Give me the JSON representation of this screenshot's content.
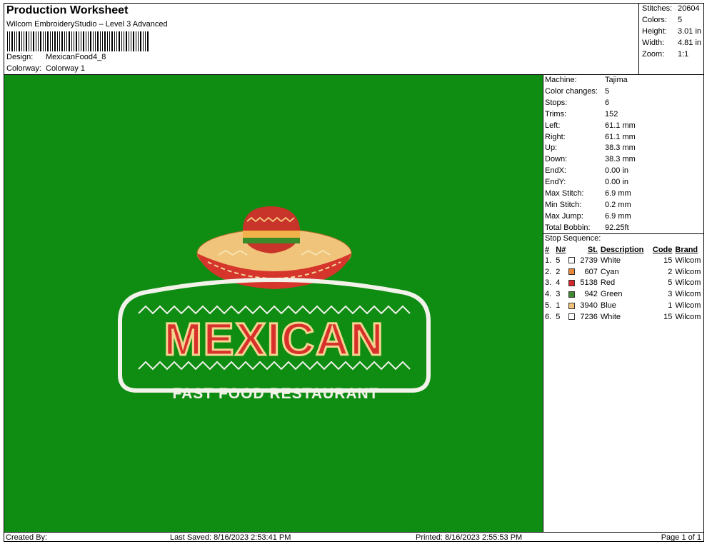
{
  "header": {
    "title": "Production Worksheet",
    "subtitle": "Wilcom EmbroideryStudio – Level 3 Advanced",
    "design_label": "Design:",
    "design_value": "MexicanFood4_8",
    "colorway_label": "Colorway:",
    "colorway_value": "Colorway 1"
  },
  "stats": [
    {
      "label": "Stitches:",
      "value": "20604"
    },
    {
      "label": "Colors:",
      "value": "5"
    },
    {
      "label": "Height:",
      "value": "3.01 in"
    },
    {
      "label": "Width:",
      "value": "4.81 in"
    },
    {
      "label": "Zoom:",
      "value": "1:1"
    }
  ],
  "machine_info": [
    {
      "label": "Machine:",
      "value": "Tajima"
    },
    {
      "label": "Color changes:",
      "value": "5"
    },
    {
      "label": "Stops:",
      "value": "6"
    },
    {
      "label": "Trims:",
      "value": "152"
    },
    {
      "label": "Left:",
      "value": "61.1 mm"
    },
    {
      "label": "Right:",
      "value": "61.1 mm"
    },
    {
      "label": "Up:",
      "value": "38.3 mm"
    },
    {
      "label": "Down:",
      "value": "38.3 mm"
    },
    {
      "label": "EndX:",
      "value": "0.00 in"
    },
    {
      "label": "EndY:",
      "value": "0.00 in"
    },
    {
      "label": "Max Stitch:",
      "value": "6.9 mm"
    },
    {
      "label": "Min Stitch:",
      "value": "0.2 mm"
    },
    {
      "label": "Max Jump:",
      "value": "6.9 mm"
    },
    {
      "label": "Total Bobbin:",
      "value": "92.25ft"
    }
  ],
  "stop_sequence": {
    "title": "Stop Sequence:",
    "columns": [
      "#",
      "N#",
      "St.",
      "Description",
      "Code",
      "Brand"
    ],
    "rows": [
      {
        "idx": "1.",
        "n": "5",
        "color": "#ffffff",
        "st": "2739",
        "desc": "White",
        "code": "15",
        "brand": "Wilcom"
      },
      {
        "idx": "2.",
        "n": "2",
        "color": "#e8873a",
        "st": "607",
        "desc": "Cyan",
        "code": "2",
        "brand": "Wilcom"
      },
      {
        "idx": "3.",
        "n": "4",
        "color": "#d6252a",
        "st": "5138",
        "desc": "Red",
        "code": "5",
        "brand": "Wilcom"
      },
      {
        "idx": "4.",
        "n": "3",
        "color": "#3f8a2e",
        "st": "942",
        "desc": "Green",
        "code": "3",
        "brand": "Wilcom"
      },
      {
        "idx": "5.",
        "n": "1",
        "color": "#f2c27a",
        "st": "3940",
        "desc": "Blue",
        "code": "1",
        "brand": "Wilcom"
      },
      {
        "idx": "6.",
        "n": "5",
        "color": "#ffffff",
        "st": "7236",
        "desc": "White",
        "code": "15",
        "brand": "Wilcom"
      }
    ]
  },
  "design": {
    "background": "#0f8d13",
    "logo_text": "MEXICAN",
    "tagline": "FAST FOOD RESTAURANT"
  },
  "footer": {
    "created_by": "Created By:",
    "last_saved": "Last Saved: 8/16/2023 2:53:41 PM",
    "printed": "Printed: 8/16/2023 2:55:53 PM",
    "page": "Page 1 of 1"
  }
}
